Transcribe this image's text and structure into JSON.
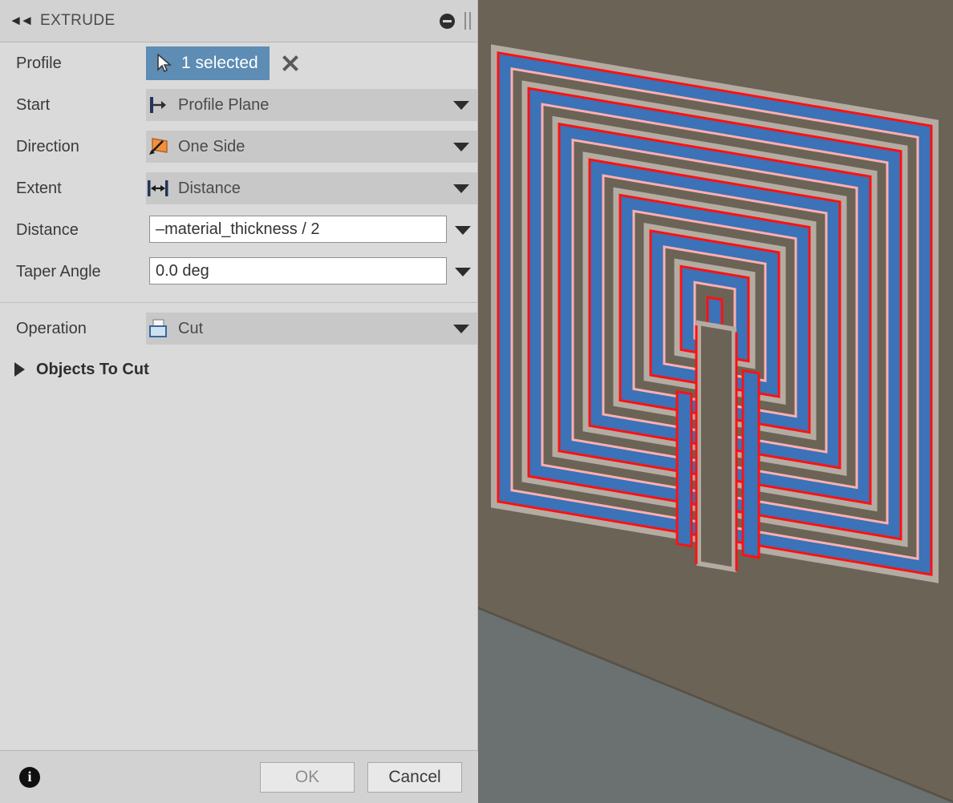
{
  "panel": {
    "title": "EXTRUDE",
    "collapse_icon": "double-left-arrow-icon",
    "minimize_icon": "minimize-icon",
    "grip_icon": "resize-grip-icon"
  },
  "form": {
    "profile": {
      "label": "Profile",
      "chip_text": "1 selected",
      "chip_icon": "select-arrow-icon",
      "clear_icon": "close-x-icon"
    },
    "start": {
      "label": "Start",
      "value": "Profile Plane",
      "icon": "profile-plane-icon"
    },
    "direction": {
      "label": "Direction",
      "value": "One Side",
      "icon": "one-side-icon"
    },
    "extent": {
      "label": "Extent",
      "value": "Distance",
      "icon": "distance-extent-icon"
    },
    "distance": {
      "label": "Distance",
      "value": "–material_thickness / 2"
    },
    "taper_angle": {
      "label": "Taper Angle",
      "value": "0.0 deg"
    },
    "operation": {
      "label": "Operation",
      "value": "Cut",
      "icon": "cut-operation-icon"
    },
    "objects_to_cut": {
      "label": "Objects To Cut",
      "expanded": false,
      "icon": "expand-triangle-icon"
    }
  },
  "footer": {
    "info_icon": "info-icon",
    "info_glyph": "i",
    "ok_label": "OK",
    "cancel_label": "Cancel"
  },
  "viewport": {
    "cursor_icon": "extrude-direction-arrow-icon",
    "colors": {
      "background": "#6b6356",
      "ground": "#93a7b0",
      "material": "#6b6356",
      "sketch_fill": "#3b72b8",
      "sketch_edge": "#ff1111",
      "body_face": "#b4aca2"
    }
  }
}
